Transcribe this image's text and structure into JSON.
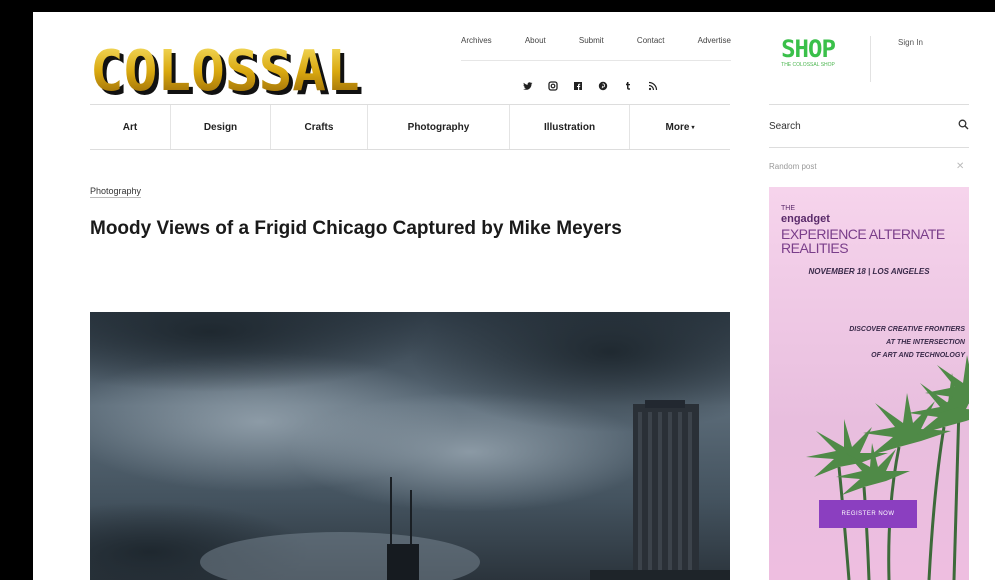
{
  "site": {
    "logo_text": "COLOSSAL"
  },
  "top_nav": [
    {
      "label": "Archives"
    },
    {
      "label": "About"
    },
    {
      "label": "Submit"
    },
    {
      "label": "Contact"
    },
    {
      "label": "Advertise"
    }
  ],
  "social_icons": [
    {
      "icon": "twitter-icon",
      "glyph": "🐦"
    },
    {
      "icon": "instagram-icon",
      "glyph": "◘"
    },
    {
      "icon": "facebook-icon",
      "glyph": "f"
    },
    {
      "icon": "pinterest-icon",
      "glyph": "℗"
    },
    {
      "icon": "tumblr-icon",
      "glyph": "t"
    },
    {
      "icon": "rss-icon",
      "glyph": "◔"
    }
  ],
  "shop": {
    "title": "SHOP",
    "subtitle": "THE COLOSSAL SHOP"
  },
  "account": {
    "signin_label": "Sign In"
  },
  "categories": [
    {
      "label": "Art"
    },
    {
      "label": "Design"
    },
    {
      "label": "Crafts"
    },
    {
      "label": "Photography"
    },
    {
      "label": "Illustration"
    },
    {
      "label": "More"
    }
  ],
  "search": {
    "placeholder": "Search"
  },
  "article": {
    "category": "Photography",
    "title": "Moody Views of a Frigid Chicago Captured by Mike Meyers"
  },
  "sidebar": {
    "ad_label": "Random post",
    "ad": {
      "the": "THE",
      "brand": "engadget",
      "headline": "EXPERIENCE ALTERNATE REALITIES",
      "date": "NOVEMBER 18 | LOS ANGELES",
      "body_lines": [
        "DISCOVER CREATIVE FRONTIERS",
        "AT THE INTERSECTION",
        "OF ART AND TECHNOLOGY"
      ],
      "cta": "REGISTER NOW"
    }
  },
  "colors": {
    "brand_yellow": "#e9c21a",
    "shop_green": "#3ac04a",
    "ad_pink": "#f3cfe8",
    "ad_cta": "#8b3fc0"
  }
}
